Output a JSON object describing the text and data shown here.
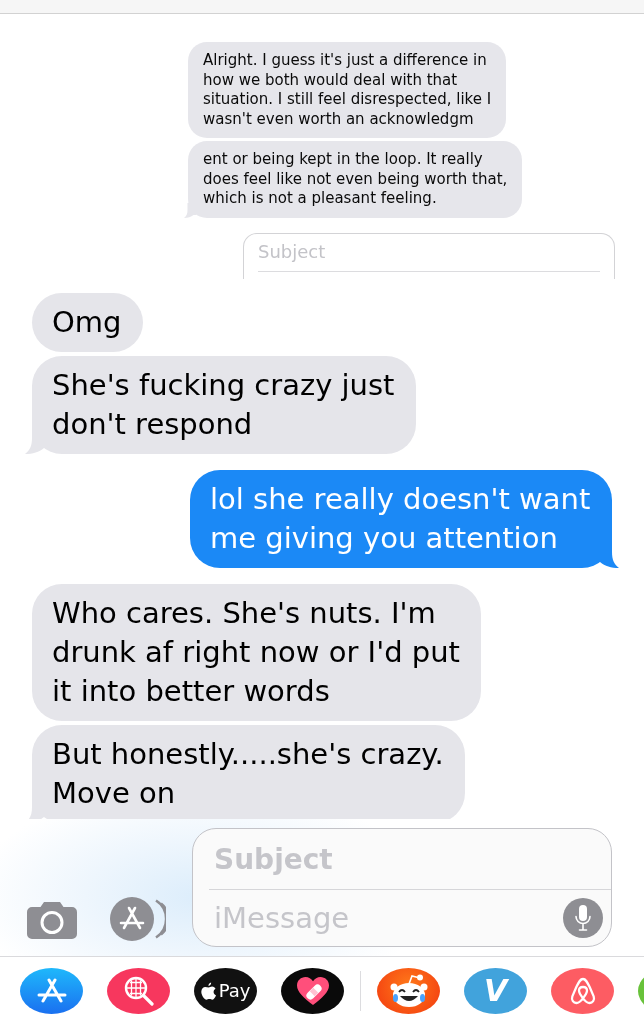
{
  "shared_screenshot": {
    "messages": [
      {
        "kind": "incoming",
        "text": "Alright. I guess it's just a difference in how we both would deal with that situation. I still feel disrespected, like I wasn't even worth an acknowledgm",
        "tail": false
      },
      {
        "kind": "incoming",
        "text": "ent or being kept in the loop. It really does feel like not even being worth that, which is not a pleasant feeling.",
        "tail": true
      }
    ],
    "subject_field": {
      "placeholder": "Subject"
    }
  },
  "messages": [
    {
      "kind": "incoming",
      "text": "Omg",
      "tail": false
    },
    {
      "kind": "incoming",
      "text": "She's fucking crazy just don't respond",
      "tail": true
    },
    {
      "kind": "outgoing",
      "text": "lol she really doesn't want me giving you attention",
      "tail": true
    },
    {
      "kind": "incoming",
      "text": "Who cares. She's nuts. I'm drunk af right now or I'd put it into better words",
      "tail": false
    },
    {
      "kind": "incoming",
      "text": "But honestly.....she's crazy. Move on",
      "tail": true
    }
  ],
  "compose": {
    "subject_field": {
      "placeholder": "Subject"
    },
    "message_field": {
      "placeholder": "iMessage"
    }
  },
  "app_drawer": {
    "groups": [
      [
        {
          "kind": "store"
        },
        {
          "kind": "finder"
        },
        {
          "kind": "pay",
          "label": "Pay"
        },
        {
          "kind": "heart"
        }
      ],
      [
        {
          "kind": "alien"
        },
        {
          "kind": "letter",
          "label": "V"
        },
        {
          "kind": "loop"
        },
        {
          "kind": "leaf"
        }
      ]
    ]
  }
}
